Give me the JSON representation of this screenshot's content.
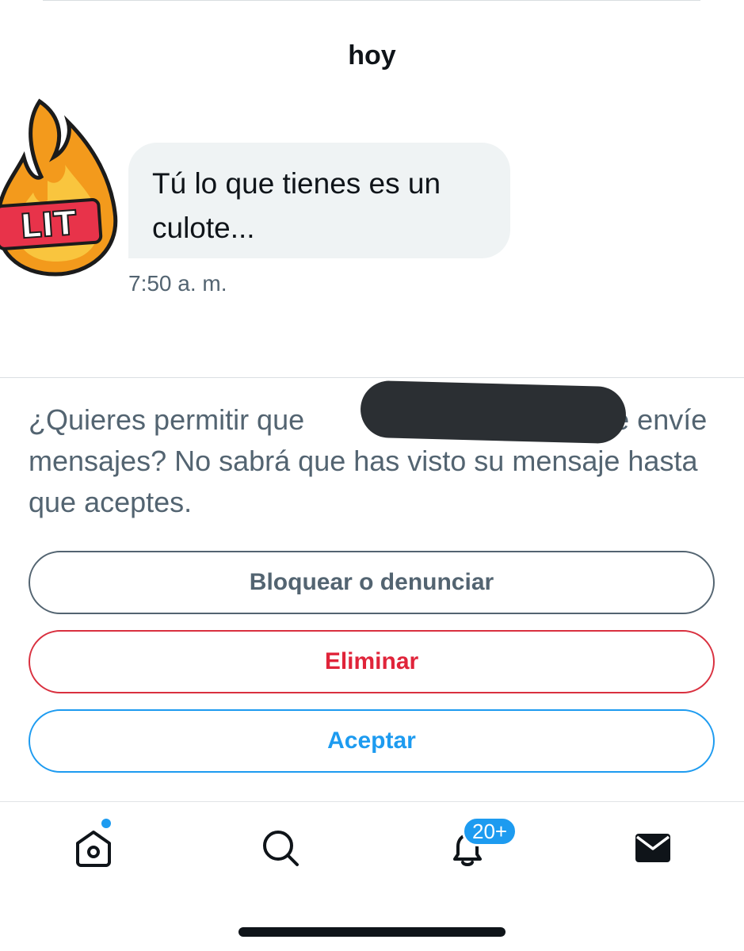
{
  "conversation": {
    "day_label": "hoy",
    "avatar_label": "LIT",
    "message": {
      "text": "Tú lo que tienes es un culote...",
      "time": "7:50 a. m."
    }
  },
  "request": {
    "text_before": "¿Quieres permitir que ",
    "text_after": "a te envíe mensajes? No sabrá que has visto su mensaje hasta que aceptes."
  },
  "actions": {
    "block_label": "Bloquear o denunciar",
    "delete_label": "Eliminar",
    "accept_label": "Aceptar"
  },
  "tabbar": {
    "items": [
      {
        "icon": "home-icon",
        "has_dot": true
      },
      {
        "icon": "search-icon"
      },
      {
        "icon": "bell-icon",
        "badge": "20+"
      },
      {
        "icon": "mail-icon"
      }
    ]
  },
  "colors": {
    "accent": "#1d9bf0",
    "danger": "#d9303f",
    "muted": "#536471",
    "bubble": "#eff3f4"
  }
}
